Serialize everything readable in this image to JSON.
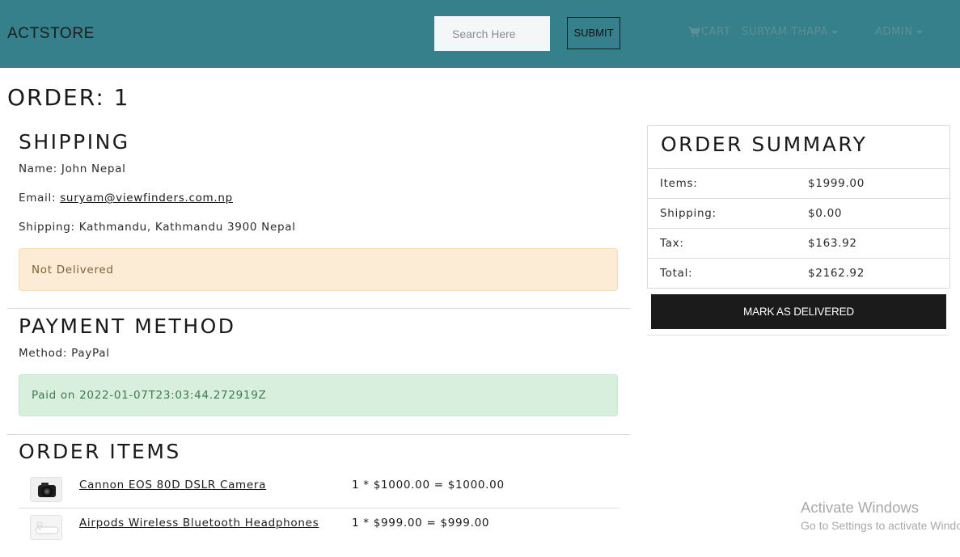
{
  "navbar": {
    "brand": "ACTSTORE",
    "search_placeholder": "Search Here",
    "search_value": "",
    "submit_label": "SUBMIT",
    "cart_label": "CART",
    "user_label": "SURYAM THAPA",
    "admin_label": "ADMIN",
    "bar_color": "#35808a"
  },
  "page": {
    "title": "ORDER: 1"
  },
  "shipping": {
    "heading": "SHIPPING",
    "name_label": "Name:",
    "name_value": "John Nepal",
    "email_label": "Email:",
    "email_value": "suryam@viewfinders.com.np",
    "address_label": "Shipping:",
    "address_value": "Kathmandu, Kathmandu 3900 Nepal",
    "status": "Not Delivered"
  },
  "payment": {
    "heading": "PAYMENT METHOD",
    "method_label": "Method:",
    "method_value": "PayPal",
    "status": "Paid on 2022-01-07T23:03:44.272919Z"
  },
  "order_items": {
    "heading": "ORDER ITEMS",
    "items": [
      {
        "name": "Cannon EOS 80D DSLR Camera",
        "calc": "1 * $1000.00 = $1000.00",
        "thumb_icon": "camera-icon"
      },
      {
        "name": "Airpods Wireless Bluetooth Headphones",
        "calc": "1 * $999.00 = $999.00",
        "thumb_icon": "airpods-icon"
      }
    ]
  },
  "summary": {
    "heading": "ORDER SUMMARY",
    "rows": [
      {
        "label": "Items:",
        "value": "$1999.00"
      },
      {
        "label": "Shipping:",
        "value": "$0.00"
      },
      {
        "label": "Tax:",
        "value": "$163.92"
      },
      {
        "label": "Total:",
        "value": "$2162.92"
      }
    ],
    "deliver_button": "MARK AS DELIVERED"
  },
  "watermark": {
    "title": "Activate Windows",
    "subtitle": "Go to Settings to activate Windows."
  }
}
